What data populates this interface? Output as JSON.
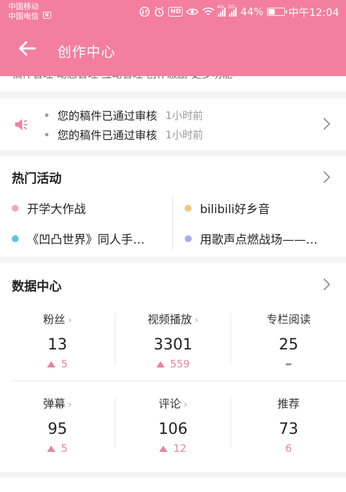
{
  "status_bar": {
    "carrier_1": "中国移动",
    "carrier_2": "中国电信",
    "battery_percent": "44%",
    "time": "中午12:04",
    "network_1": "4G",
    "network_2": "2G",
    "hd_badge": "HD",
    "battery_level": 0.44
  },
  "header": {
    "title": "创作中心"
  },
  "tools_strip": {
    "ghost_text": "稿件管理    动态管理    互动管理    创作激励    更多功能"
  },
  "notices": [
    {
      "text": "您的稿件已通过审核",
      "time": "1小时前"
    },
    {
      "text": "您的稿件已通过审核",
      "time": "1小时前"
    }
  ],
  "hot": {
    "title": "热门活动",
    "items": [
      {
        "label": "开学大作战",
        "color": "#f4a7bf"
      },
      {
        "label": "bilibili好乡音",
        "color": "#f5c67a"
      },
      {
        "label": "《凹凸世界》同人手…",
        "color": "#56c4e8"
      },
      {
        "label": "用歌声点燃战场——…",
        "color": "#a9aaf3"
      }
    ]
  },
  "data_center": {
    "title": "数据中心",
    "stats": [
      {
        "label": "粉丝",
        "value": "13",
        "delta": "5",
        "has_arrow": true,
        "trend": "up"
      },
      {
        "label": "视频播放",
        "value": "3301",
        "delta": "559",
        "has_arrow": true,
        "trend": "up"
      },
      {
        "label": "专栏阅读",
        "value": "25",
        "delta": "-",
        "has_arrow": false,
        "trend": "none"
      },
      {
        "label": "弹幕",
        "value": "95",
        "delta": "5",
        "has_arrow": true,
        "trend": "up"
      },
      {
        "label": "评论",
        "value": "106",
        "delta": "12",
        "has_arrow": true,
        "trend": "up"
      },
      {
        "label": "推荐",
        "value": "73",
        "delta": "6",
        "has_arrow": false,
        "trend": "plain"
      }
    ]
  },
  "colors": {
    "brand_pink": "#f47ea0",
    "delta_pink": "#f07fa0"
  }
}
